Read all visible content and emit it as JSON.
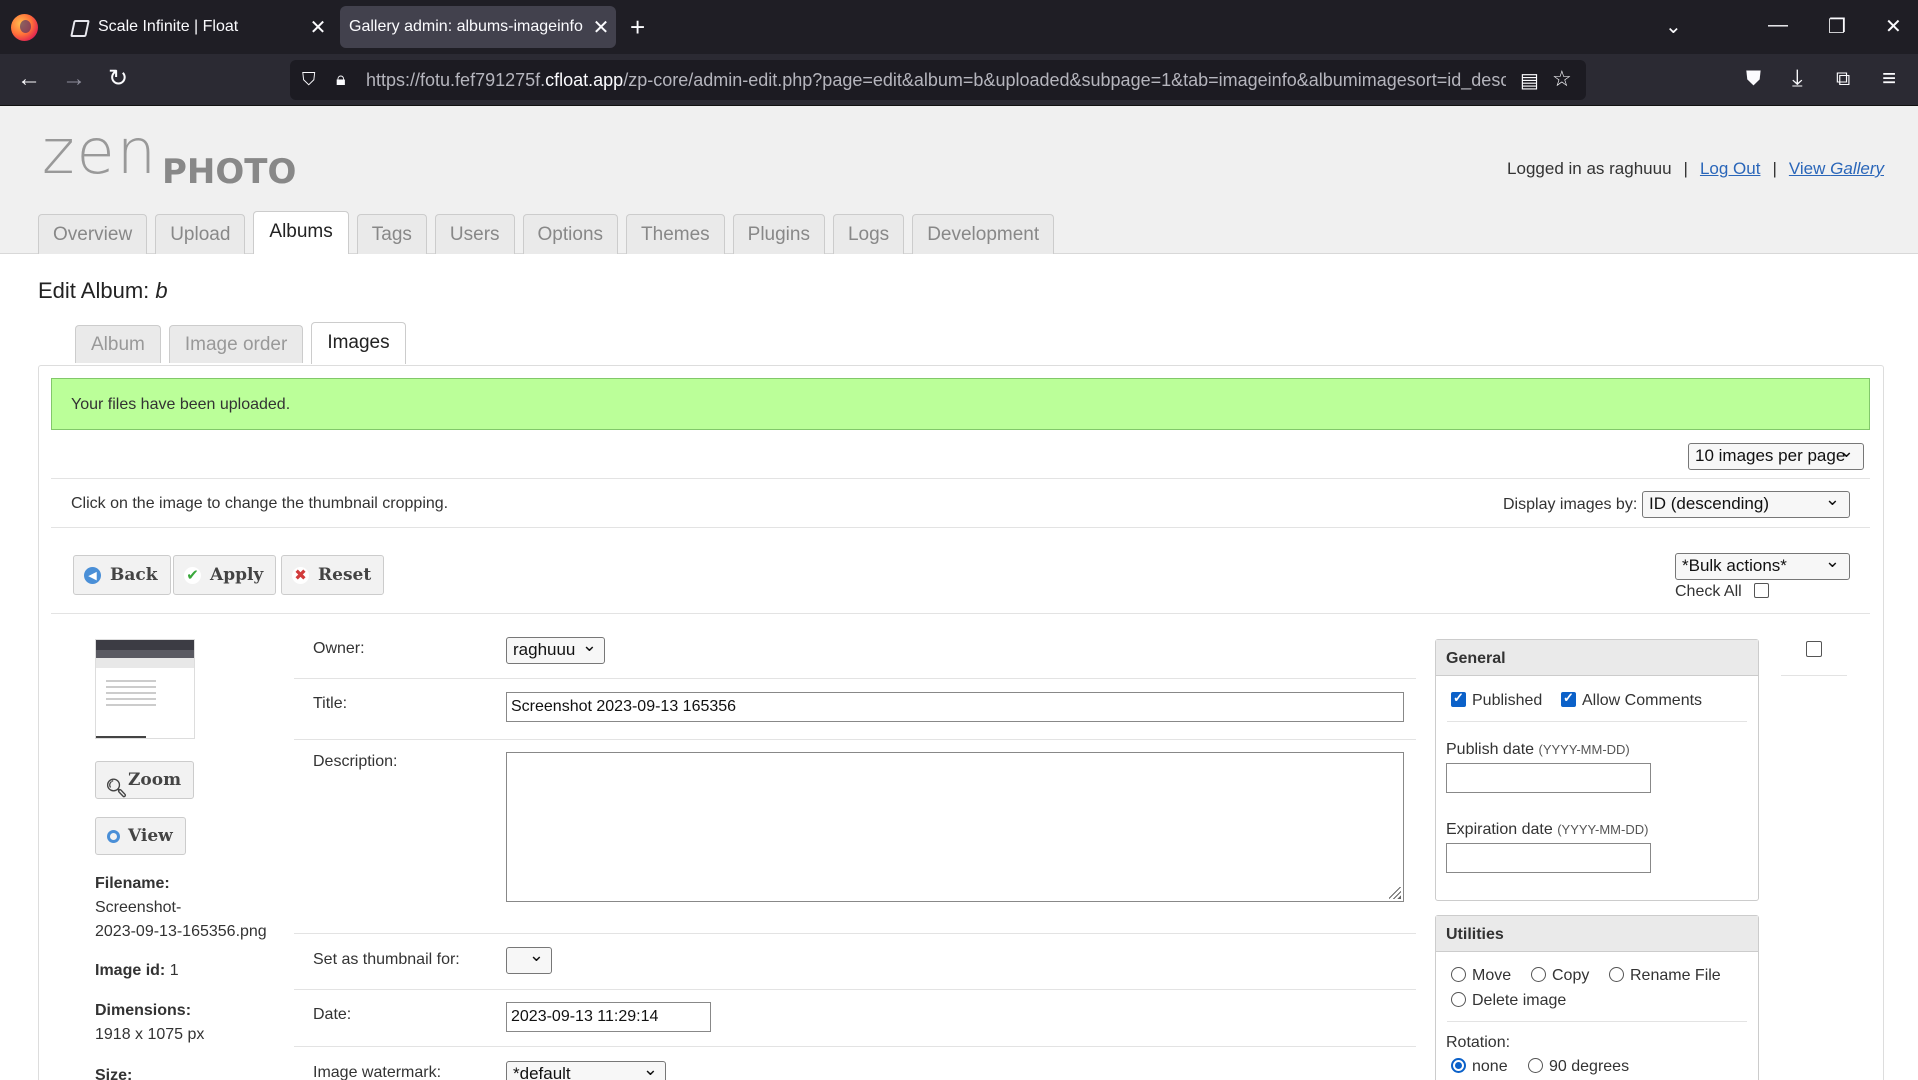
{
  "browser": {
    "tabs": [
      {
        "title": "Scale Infinite | Float"
      },
      {
        "title": "Gallery admin: albums-imageinfo"
      }
    ],
    "url_prefix": "https://fotu.fef791275f.",
    "url_domain": "cfloat.app",
    "url_path": "/zp-core/admin-edit.php?page=edit&album=b&uploaded&subpage=1&tab=imageinfo&albumimagesort=id_desc"
  },
  "header": {
    "logo_zen": "zen",
    "logo_photo": "PHOTO",
    "logged_in_text": "Logged in as raghuuu",
    "logout_label": "Log Out",
    "view_label": "View ",
    "view_label_em": "Gallery"
  },
  "main_tabs": [
    "Overview",
    "Upload",
    "Albums",
    "Tags",
    "Users",
    "Options",
    "Themes",
    "Plugins",
    "Logs",
    "Development"
  ],
  "page": {
    "title_prefix": "Edit Album: ",
    "album_name": "b"
  },
  "sub_tabs": [
    "Album",
    "Image order",
    "Images"
  ],
  "messages": {
    "success": "Your files have been uploaded."
  },
  "controls": {
    "per_page": "10 images per page",
    "hint": "Click on the image to change the thumbnail cropping.",
    "display_by_label": "Display images by:",
    "display_by_value": "ID (descending)",
    "back": "Back",
    "apply": "Apply",
    "reset": "Reset",
    "bulk_actions": "*Bulk actions*",
    "check_all": "Check All"
  },
  "image": {
    "zoom": "Zoom",
    "view": "View",
    "filename_label": "Filename:",
    "filename_line1": "Screenshot-",
    "filename_line2": "2023-09-13-165356.png",
    "id_label": "Image id:",
    "id_value": "1",
    "dimensions_label": "Dimensions:",
    "dimensions_value": "1918 x 1075 px",
    "size_label": "Size:"
  },
  "form": {
    "owner_label": "Owner:",
    "owner_value": "raghuuu",
    "title_label": "Title:",
    "title_value": "Screenshot 2023-09-13 165356",
    "description_label": "Description:",
    "thumbnail_label": "Set as thumbnail for:",
    "date_label": "Date:",
    "date_value": "2023-09-13 11:29:14",
    "watermark_label": "Image watermark:",
    "watermark_value": "*default"
  },
  "general_panel": {
    "title": "General",
    "published_label": "Published",
    "published": true,
    "comments_label": "Allow Comments",
    "comments": true,
    "publish_date_label": "Publish date",
    "publish_date_hint": "(YYYY-MM-DD)",
    "expiration_date_label": "Expiration date",
    "expiration_date_hint": "(YYYY-MM-DD)"
  },
  "utilities_panel": {
    "title": "Utilities",
    "move": "Move",
    "copy": "Copy",
    "rename": "Rename File",
    "delete": "Delete image",
    "rotation_label": "Rotation:",
    "rot_none": "none",
    "rot_90": "90 degrees",
    "rotation_selected": "none"
  },
  "colors": {
    "success_bg": "#bbff99",
    "link": "#2a66b9",
    "checkbox_accent": "#0b61c9"
  }
}
